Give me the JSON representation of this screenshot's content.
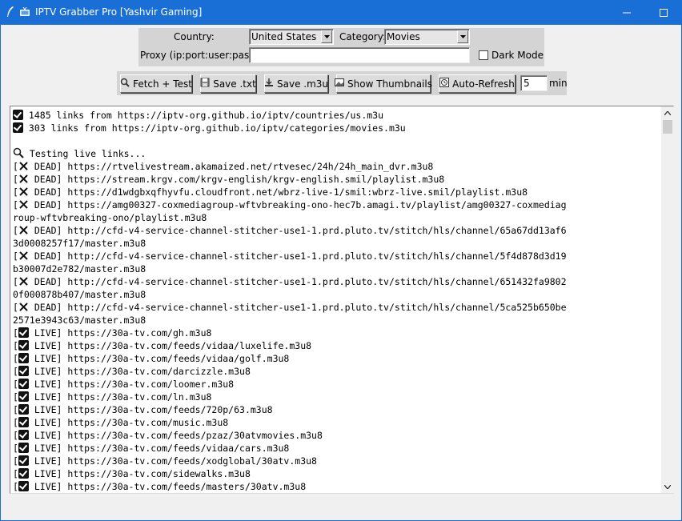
{
  "window": {
    "title": "IPTV Grabber Pro [Yashvir Gaming]",
    "accent": "#1a6fd6"
  },
  "form": {
    "country_label": "Country:",
    "country_value": "United States",
    "category_label": "Category:",
    "category_value": "Movies",
    "proxy_label": "Proxy (ip:port:user:pass):",
    "proxy_value": "",
    "dark_mode_label": "Dark Mode",
    "dark_mode_checked": false
  },
  "toolbar": {
    "fetch_test": "Fetch + Test",
    "save_txt": "Save .txt",
    "save_m3u": "Save .m3u",
    "show_thumbnails": "Show Thumbnails",
    "auto_refresh": "Auto-Refresh",
    "interval_value": "5",
    "interval_unit": "min"
  },
  "log": {
    "lines": [
      {
        "icon": "check",
        "text": " 1485 links from https://iptv-org.github.io/iptv/countries/us.m3u"
      },
      {
        "icon": "check",
        "text": " 303 links from https://iptv-org.github.io/iptv/categories/movies.m3u"
      },
      {
        "icon": "none",
        "text": ""
      },
      {
        "icon": "search",
        "text": " Testing live links..."
      },
      {
        "icon": "cross",
        "pre": "[",
        "text": " DEAD] https://rtvelivestream.akamaized.net/rtvesec/24h/24h_main_dvr.m3u8"
      },
      {
        "icon": "cross",
        "pre": "[",
        "text": " DEAD] https://stream.krgv.com/krgv-english/krgv-english.smil/playlist.m3u8"
      },
      {
        "icon": "cross",
        "pre": "[",
        "text": " DEAD] https://d1wdgbxqfhyvfu.cloudfront.net/wbrz-live-1/smil:wbrz-live.smil/playlist.m3u8"
      },
      {
        "icon": "cross",
        "pre": "[",
        "text": " DEAD] https://amg00327-coxmediagroup-wftvbreaking-ono-hec7b.amagi.tv/playlist/amg00327-coxmediag"
      },
      {
        "icon": "none",
        "text": "roup-wftvbreaking-ono/playlist.m3u8"
      },
      {
        "icon": "cross",
        "pre": "[",
        "text": " DEAD] http://cfd-v4-service-channel-stitcher-use1-1.prd.pluto.tv/stitch/hls/channel/65a67dd13af6"
      },
      {
        "icon": "none",
        "text": "3d0008257f17/master.m3u8"
      },
      {
        "icon": "cross",
        "pre": "[",
        "text": " DEAD] http://cfd-v4-service-channel-stitcher-use1-1.prd.pluto.tv/stitch/hls/channel/5f4d878d3d19"
      },
      {
        "icon": "none",
        "text": "b30007d2e782/master.m3u8"
      },
      {
        "icon": "cross",
        "pre": "[",
        "text": " DEAD] http://cfd-v4-service-channel-stitcher-use1-1.prd.pluto.tv/stitch/hls/channel/651432fa9802"
      },
      {
        "icon": "none",
        "text": "0f000878b407/master.m3u8"
      },
      {
        "icon": "cross",
        "pre": "[",
        "text": " DEAD] http://cfd-v4-service-channel-stitcher-use1-1.prd.pluto.tv/stitch/hls/channel/5ca525b650be"
      },
      {
        "icon": "none",
        "text": "2571e3943c63/master.m3u8"
      },
      {
        "icon": "check",
        "pre": "[",
        "text": " LIVE] https://30a-tv.com/gh.m3u8"
      },
      {
        "icon": "check",
        "pre": "[",
        "text": " LIVE] https://30a-tv.com/feeds/vidaa/luxelife.m3u8"
      },
      {
        "icon": "check",
        "pre": "[",
        "text": " LIVE] https://30a-tv.com/feeds/vidaa/golf.m3u8"
      },
      {
        "icon": "check",
        "pre": "[",
        "text": " LIVE] https://30a-tv.com/darcizzle.m3u8"
      },
      {
        "icon": "check",
        "pre": "[",
        "text": " LIVE] https://30a-tv.com/loomer.m3u8"
      },
      {
        "icon": "check",
        "pre": "[",
        "text": " LIVE] https://30a-tv.com/ln.m3u8"
      },
      {
        "icon": "check",
        "pre": "[",
        "text": " LIVE] https://30a-tv.com/feeds/720p/63.m3u8"
      },
      {
        "icon": "check",
        "pre": "[",
        "text": " LIVE] https://30a-tv.com/music.m3u8"
      },
      {
        "icon": "check",
        "pre": "[",
        "text": " LIVE] https://30a-tv.com/feeds/pzaz/30atvmovies.m3u8"
      },
      {
        "icon": "check",
        "pre": "[",
        "text": " LIVE] https://30a-tv.com/feeds/vidaa/cars.m3u8"
      },
      {
        "icon": "check",
        "pre": "[",
        "text": " LIVE] https://30a-tv.com/feeds/xodglobal/30atv.m3u8"
      },
      {
        "icon": "check",
        "pre": "[",
        "text": " LIVE] https://30a-tv.com/sidewalks.m3u8"
      },
      {
        "icon": "check",
        "pre": "[",
        "text": " LIVE] https://30a-tv.com/feeds/masters/30atv.m3u8"
      }
    ]
  }
}
